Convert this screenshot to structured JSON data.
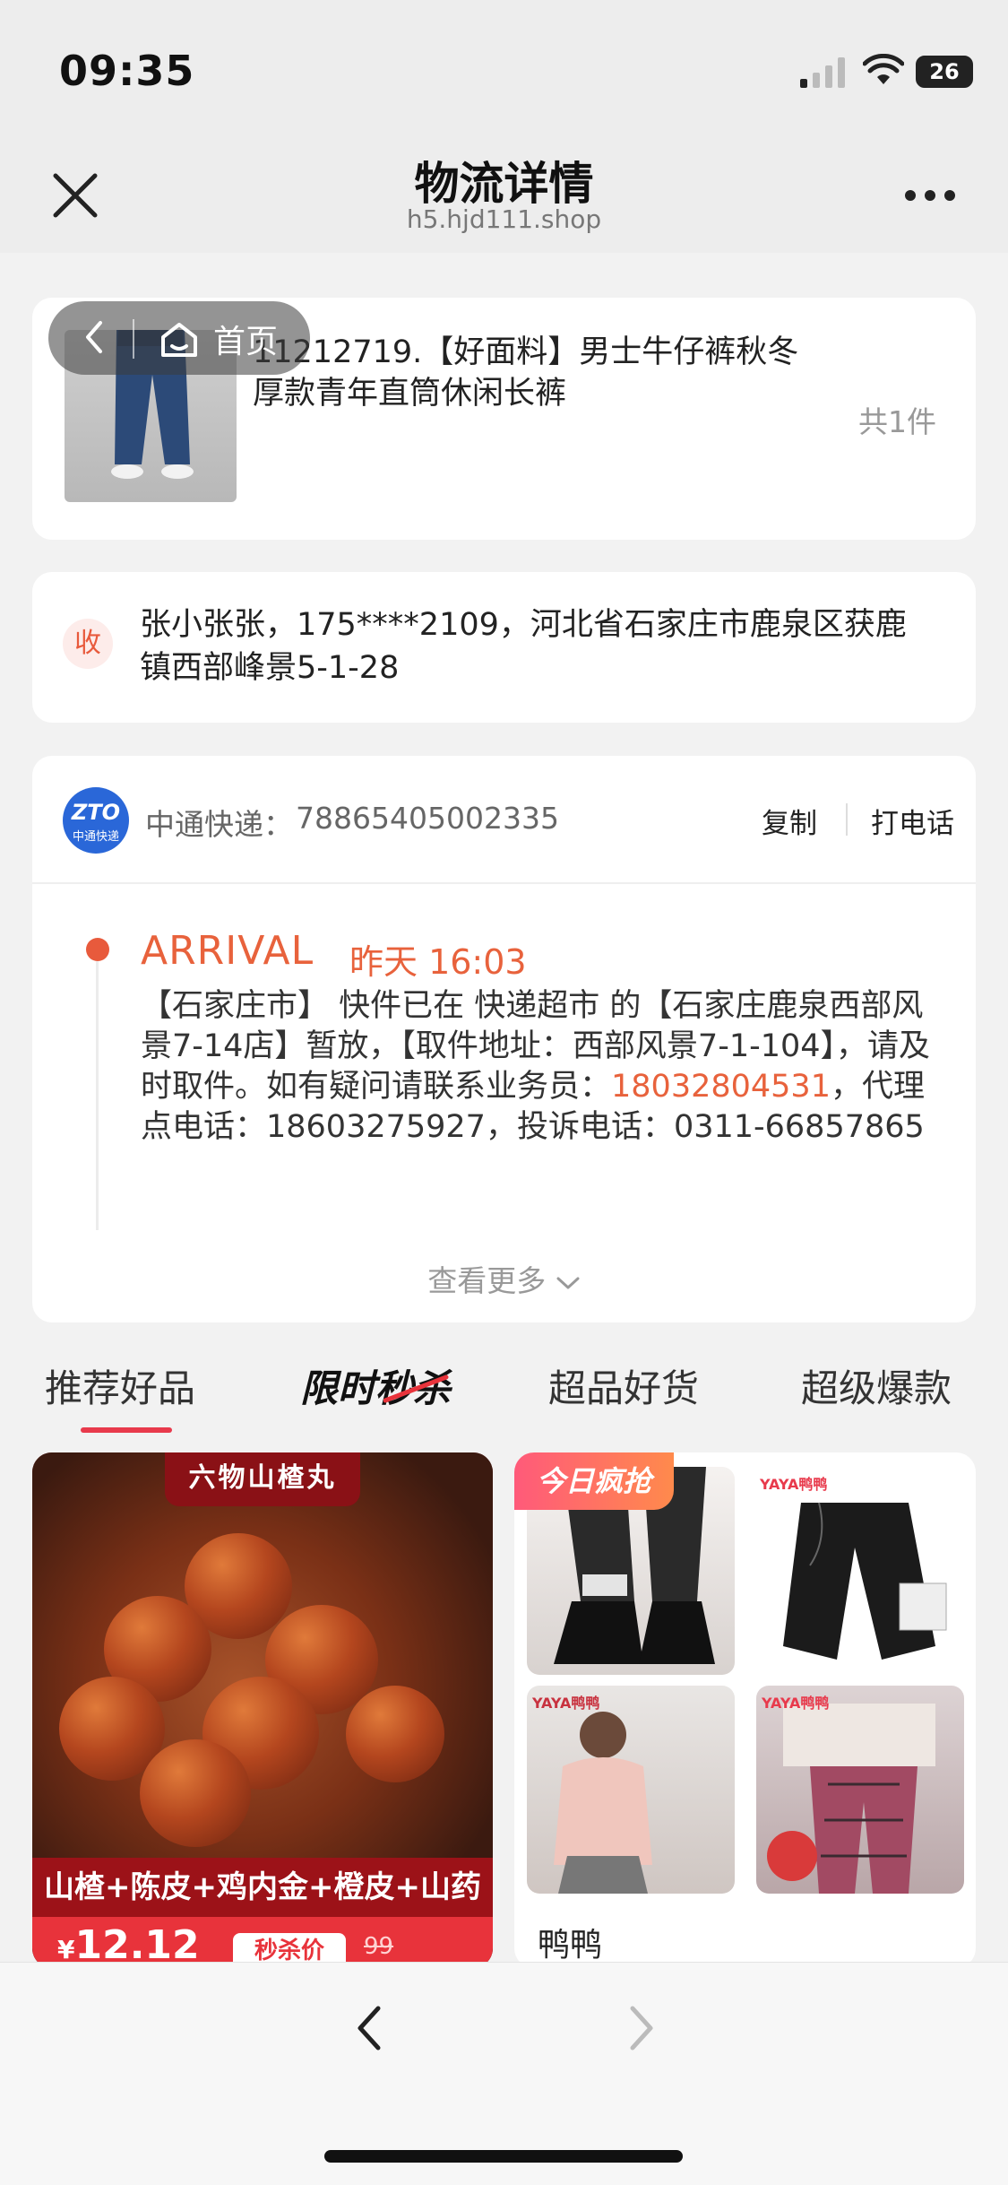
{
  "status_bar": {
    "time": "09:35",
    "battery": "26"
  },
  "nav": {
    "title": "物流详情",
    "subtitle": "h5.hjd111.shop"
  },
  "floating_nav": {
    "home_label": "首页"
  },
  "product": {
    "title": "11212719.【好面料】男士牛仔裤秋冬厚款青年直筒休闲长裤",
    "count": "共1件"
  },
  "address": {
    "badge": "收",
    "text": "张小张张，175****2109，河北省石家庄市鹿泉区获鹿镇西部峰景5-1-28"
  },
  "logistics": {
    "logo_text": "ZTO",
    "logo_sub": "中通快递",
    "carrier_label": "中通快递：",
    "tracking_number": "78865405002335",
    "copy_label": "复制",
    "call_label": "打电话",
    "latest": {
      "status": "ARRIVAL",
      "time": "昨天 16:03",
      "detail_before": "【石家庄市】 快件已在 快递超市 的【石家庄鹿泉西部风景7-14店】暂放，【取件地址：西部风景7-1-104】，请及时取件。如有疑问请联系业务员：",
      "courier_phone": "18032804531",
      "detail_after": "，代理点电话：18603275927，投诉电话：0311-66857865"
    },
    "view_more": "查看更多"
  },
  "tabs": [
    {
      "label": "推荐好品",
      "active": true
    },
    {
      "label": "限时秒杀",
      "active": false
    },
    {
      "label": "超品好货",
      "active": false
    },
    {
      "label": "超级爆款",
      "active": false
    }
  ],
  "promo_product": {
    "banner": "六物山楂丸",
    "ingredients": "山楂+陈皮+鸡内金+橙皮+山药+茯苓",
    "currency": "¥",
    "price": "12.12",
    "tag": "秒杀价",
    "original_price": "99"
  },
  "grid_product": {
    "badge": "今日疯抢",
    "brand_logo": "YAYA鸭鸭",
    "name": "鸭鸭"
  },
  "colors": {
    "accent": "#e8623c",
    "tab_indicator": "#e83a4c",
    "zto_blue": "#2a67d8"
  }
}
